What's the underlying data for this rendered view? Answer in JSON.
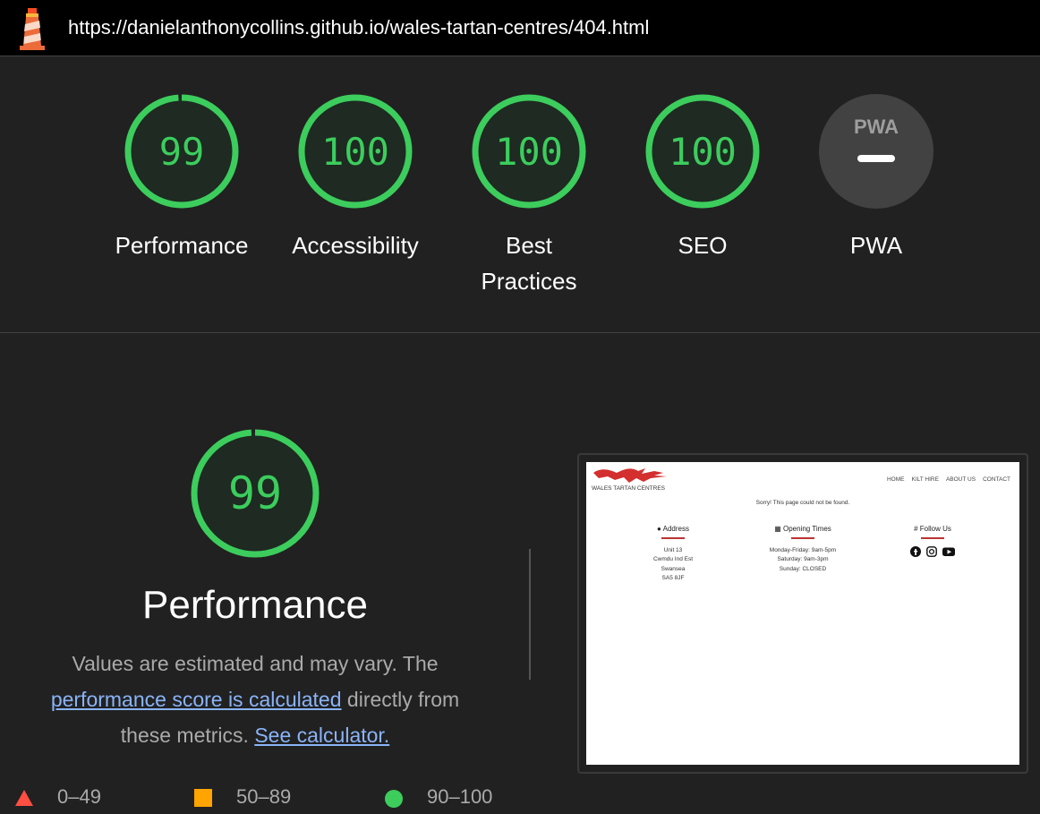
{
  "url_bar": {
    "url": "https://danielanthonycollins.github.io/wales-tartan-centres/404.html"
  },
  "gauges": [
    {
      "label": "Performance",
      "score": "99",
      "value": 99,
      "color": "#3ccd5d"
    },
    {
      "label": "Accessibility",
      "score": "100",
      "value": 100,
      "color": "#3ccd5d"
    },
    {
      "label": "Best Practices",
      "score": "100",
      "value": 100,
      "color": "#3ccd5d"
    },
    {
      "label": "SEO",
      "score": "100",
      "value": 100,
      "color": "#3ccd5d"
    },
    {
      "label": "PWA",
      "badge": "PWA",
      "color": "#9e9e9e"
    }
  ],
  "performance": {
    "score": "99",
    "value": 99,
    "title": "Performance",
    "desc_prefix": "Values are estimated and may vary. The ",
    "desc_link1": "performance score is calculated",
    "desc_middle": " directly from these metrics. ",
    "desc_link2": "See calculator."
  },
  "legend": [
    {
      "shape": "triangle",
      "range": "0–49",
      "color": "#ff4e42"
    },
    {
      "shape": "square",
      "range": "50–89",
      "color": "#ffa400"
    },
    {
      "shape": "circle",
      "range": "90–100",
      "color": "#3ccd5d"
    }
  ],
  "thumbnail": {
    "brand": "WALES TARTAN CENTRES",
    "nav": [
      "HOME",
      "KILT HIRE",
      "ABOUT US",
      "CONTACT"
    ],
    "message": "Sorry! This page could not be found.",
    "address_title": "Address",
    "address_lines": [
      "Unit 13",
      "Cwmdu Ind Est",
      "Swansea",
      "SA5 8JF"
    ],
    "times_title": "Opening Times",
    "times_lines": [
      "Monday-Friday: 9am-5pm",
      "Saturday: 9am-3pm",
      "Sunday: CLOSED"
    ],
    "follow_title": "Follow Us",
    "social": [
      "facebook-icon",
      "instagram-icon",
      "youtube-icon"
    ]
  },
  "colors": {
    "pass": "#3ccd5d",
    "average": "#ffa400",
    "fail": "#ff4e42",
    "link": "#8ab4f8"
  }
}
